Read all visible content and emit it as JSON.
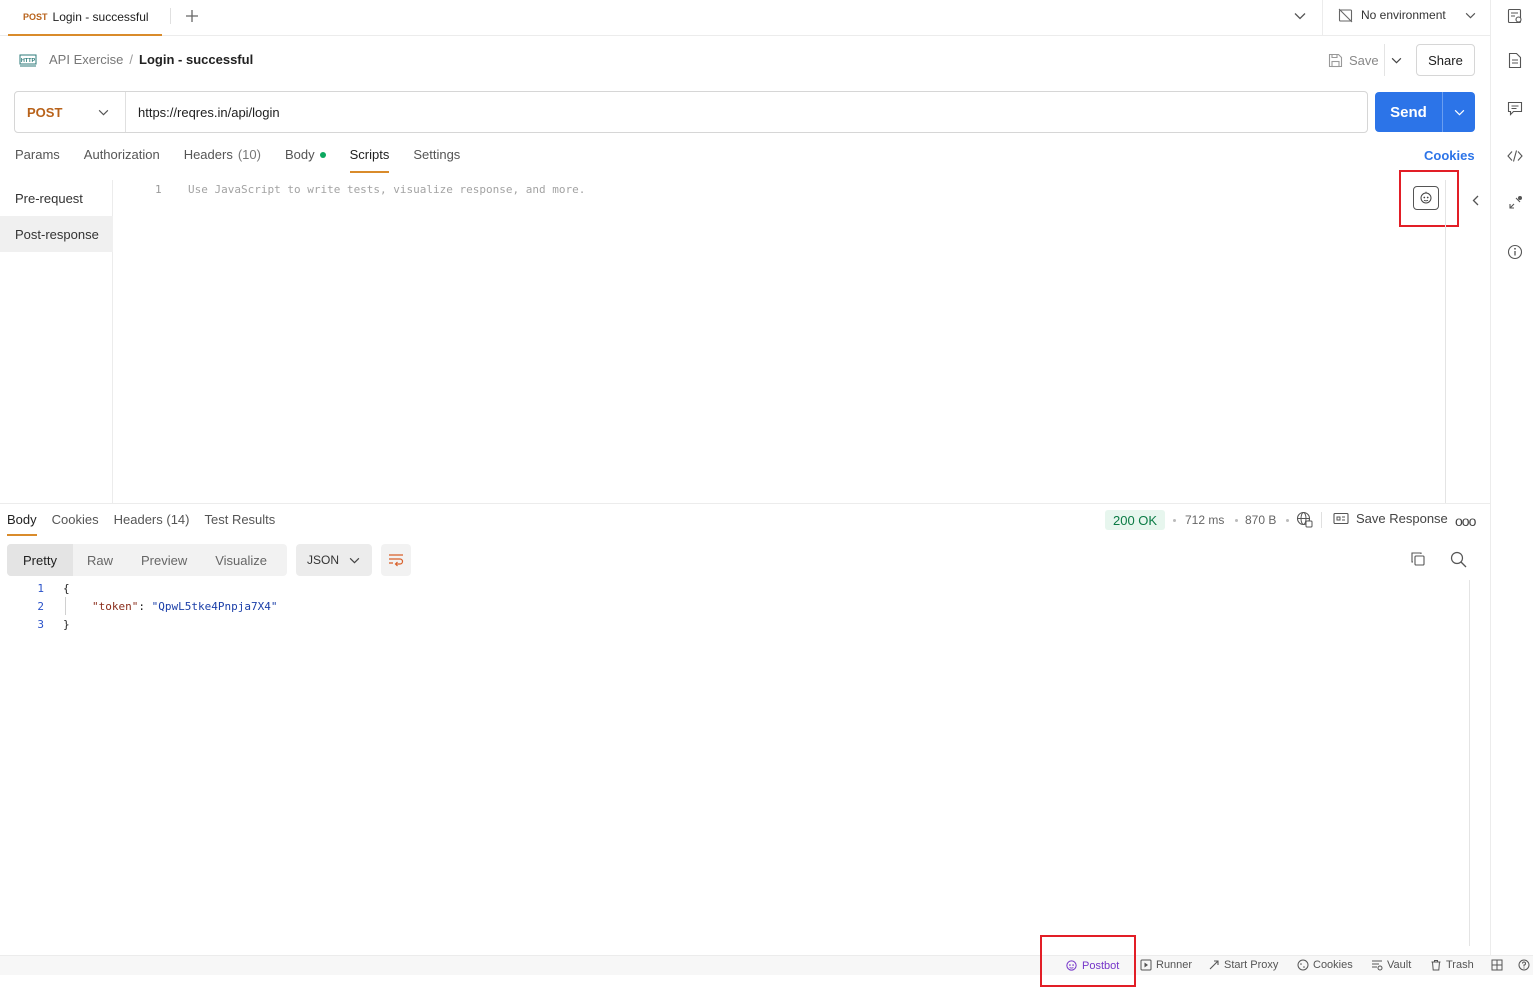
{
  "tab": {
    "method": "POST",
    "title": "Login - successful"
  },
  "environment": {
    "label": "No environment"
  },
  "breadcrumb": {
    "collection": "API Exercise",
    "separator": "/",
    "request": "Login - successful"
  },
  "header_actions": {
    "save_label": "Save",
    "share_label": "Share"
  },
  "request": {
    "method": "POST",
    "url": "https://reqres.in/api/login",
    "send_label": "Send"
  },
  "request_tabs": {
    "params": "Params",
    "authorization": "Authorization",
    "headers": "Headers",
    "headers_count": "(10)",
    "body": "Body",
    "scripts": "Scripts",
    "settings": "Settings",
    "active": "Scripts",
    "cookies_link": "Cookies"
  },
  "scripts": {
    "pre_request": "Pre-request",
    "post_response": "Post-response",
    "active": "Post-response",
    "line_number": "1",
    "placeholder": "Use JavaScript to write tests, visualize response, and more."
  },
  "response": {
    "tabs": {
      "body": "Body",
      "cookies": "Cookies",
      "headers": "Headers (14)",
      "test_results": "Test Results"
    },
    "status": "200 OK",
    "time": "712 ms",
    "size": "870 B",
    "save_response": "Save Response",
    "more": "ooo",
    "formats": {
      "pretty": "Pretty",
      "raw": "Raw",
      "preview": "Preview",
      "visualize": "Visualize",
      "active": "Pretty"
    },
    "language": "JSON",
    "body_lines": [
      {
        "no": "1",
        "text": "{"
      },
      {
        "no": "2",
        "key": "\"token\"",
        "colon": ": ",
        "value": "\"QpwL5tke4Pnpja7X4\""
      },
      {
        "no": "3",
        "text": "}"
      }
    ]
  },
  "status_bar": {
    "postbot": "Postbot",
    "runner": "Runner",
    "start_proxy": "Start Proxy",
    "cookies": "Cookies",
    "vault": "Vault",
    "trash": "Trash"
  },
  "colors": {
    "accent_orange": "#d98b2b",
    "send_blue": "#2c74e8",
    "status_green": "#0b7b45",
    "postbot_purple": "#7535c9",
    "highlight_red": "#e21e26"
  },
  "icons": [
    "plus-icon",
    "chevron-down-icon",
    "no-environment-icon",
    "http-icon",
    "save-icon",
    "postbot-icon",
    "chevron-left-icon",
    "globe-icon",
    "save-response-icon",
    "wrap-icon",
    "copy-icon",
    "search-icon",
    "runner-icon",
    "proxy-icon",
    "cookie-icon",
    "vault-icon",
    "trash-icon",
    "layout-icon",
    "help-icon",
    "documentation-icon",
    "comments-icon",
    "code-icon",
    "related-icon",
    "info-icon",
    "environment-icon"
  ]
}
